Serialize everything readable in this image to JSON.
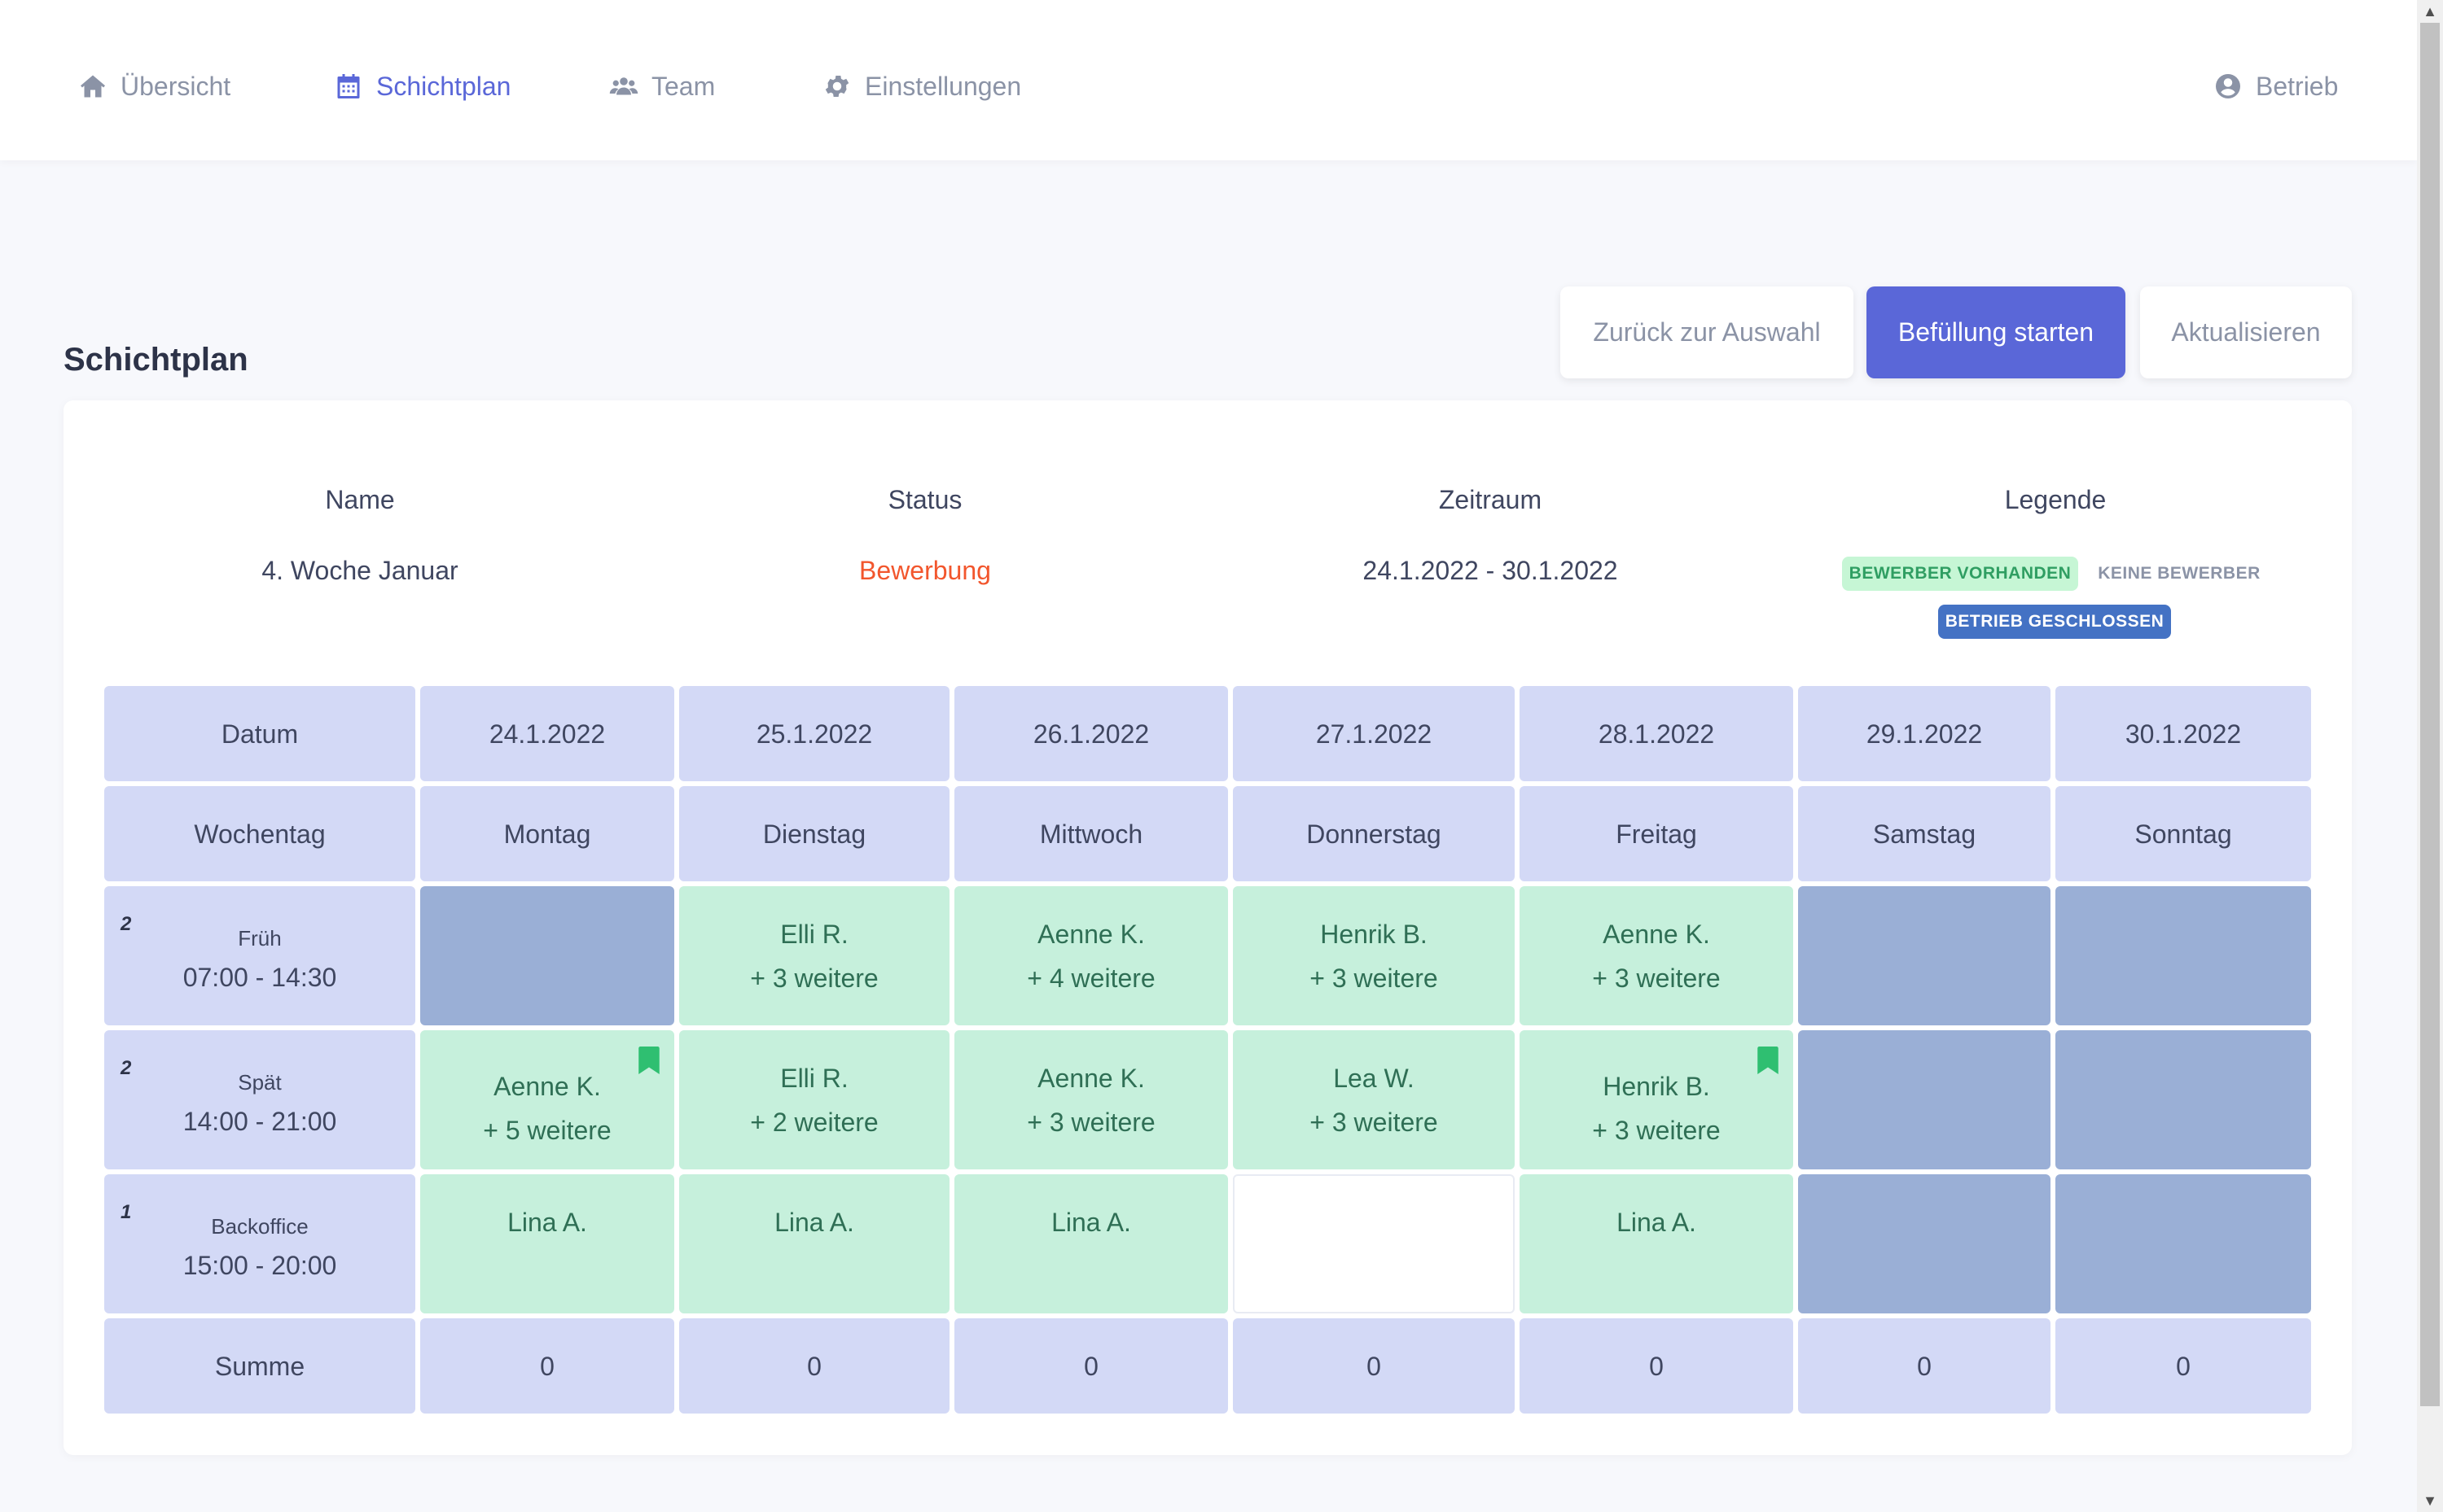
{
  "nav": {
    "items": [
      {
        "label": "Übersicht",
        "icon": "home-icon"
      },
      {
        "label": "Schichtplan",
        "icon": "calendar-icon",
        "active": true
      },
      {
        "label": "Team",
        "icon": "users-icon"
      },
      {
        "label": "Einstellungen",
        "icon": "gear-icon"
      }
    ],
    "user": {
      "label": "Betrieb",
      "icon": "user-circle-icon"
    }
  },
  "page": {
    "title": "Schichtplan",
    "buttons": {
      "back": "Zurück zur Auswahl",
      "start": "Befüllung starten",
      "refresh": "Aktualisieren"
    }
  },
  "info": {
    "name_label": "Name",
    "name_value": "4. Woche Januar",
    "status_label": "Status",
    "status_value": "Bewerbung",
    "period_label": "Zeitraum",
    "period_value": "24.1.2022 - 30.1.2022",
    "legend_label": "Legende",
    "legend": {
      "has_applicants": "BEWERBER VORHANDEN",
      "no_applicants": "KEINE BEWERBER",
      "closed": "BETRIEB GESCHLOSSEN"
    }
  },
  "colors": {
    "accent": "#5a67d8",
    "status": "#f2562d",
    "applicants": "#c6f0dc",
    "closed": "#9aafd6",
    "header": "#d3d9f6"
  },
  "table": {
    "date_label": "Datum",
    "weekday_label": "Wochentag",
    "sum_label": "Summe",
    "dates": [
      "24.1.2022",
      "25.1.2022",
      "26.1.2022",
      "27.1.2022",
      "28.1.2022",
      "29.1.2022",
      "30.1.2022"
    ],
    "weekdays": [
      "Montag",
      "Dienstag",
      "Mittwoch",
      "Donnerstag",
      "Freitag",
      "Samstag",
      "Sonntag"
    ],
    "shifts": [
      {
        "count": "2",
        "name": "Früh",
        "time": "07:00 - 14:30",
        "cells": [
          {
            "state": "closed"
          },
          {
            "state": "open",
            "line1": "Elli R.",
            "line2": "+ 3 weitere"
          },
          {
            "state": "open",
            "line1": "Aenne K.",
            "line2": "+ 4 weitere"
          },
          {
            "state": "open",
            "line1": "Henrik B.",
            "line2": "+ 3 weitere"
          },
          {
            "state": "open",
            "line1": "Aenne K.",
            "line2": "+ 3 weitere"
          },
          {
            "state": "closed"
          },
          {
            "state": "closed"
          }
        ]
      },
      {
        "count": "2",
        "name": "Spät",
        "time": "14:00 - 21:00",
        "cells": [
          {
            "state": "open",
            "line1": "Aenne K.",
            "line2": "+ 5 weitere",
            "bookmark": true
          },
          {
            "state": "open",
            "line1": "Elli R.",
            "line2": "+ 2 weitere"
          },
          {
            "state": "open",
            "line1": "Aenne K.",
            "line2": "+ 3 weitere"
          },
          {
            "state": "open",
            "line1": "Lea W.",
            "line2": "+ 3 weitere"
          },
          {
            "state": "open",
            "line1": "Henrik B.",
            "line2": "+ 3 weitere",
            "bookmark": true
          },
          {
            "state": "closed"
          },
          {
            "state": "closed"
          }
        ]
      },
      {
        "count": "1",
        "name": "Backoffice",
        "time": "15:00 - 20:00",
        "cells": [
          {
            "state": "open",
            "line1": "Lina A.",
            "line2": ""
          },
          {
            "state": "open",
            "line1": "Lina A.",
            "line2": ""
          },
          {
            "state": "open",
            "line1": "Lina A.",
            "line2": ""
          },
          {
            "state": "empty"
          },
          {
            "state": "open",
            "line1": "Lina A.",
            "line2": ""
          },
          {
            "state": "closed"
          },
          {
            "state": "closed"
          }
        ]
      }
    ],
    "sums": [
      "0",
      "0",
      "0",
      "0",
      "0",
      "0",
      "0"
    ]
  }
}
